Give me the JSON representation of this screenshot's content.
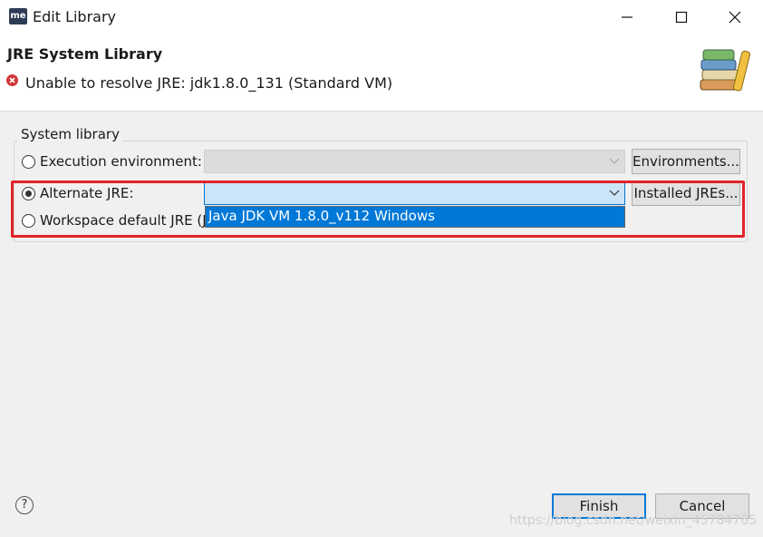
{
  "window": {
    "title": "Edit Library",
    "app_icon_text": "me"
  },
  "header": {
    "title": "JRE System Library",
    "error_message": "Unable to resolve JRE: jdk1.8.0_131 (Standard VM)"
  },
  "group": {
    "label": "System library",
    "options": {
      "execution_environment": {
        "label": "Execution environment:",
        "selected": false,
        "button": "Environments..."
      },
      "alternate_jre": {
        "label": "Alternate JRE:",
        "selected": true,
        "value": "",
        "button": "Installed JREs..."
      },
      "workspace_default": {
        "label": "Workspace default JRE (J",
        "selected": false
      }
    },
    "dropdown_items": [
      "Java JDK VM 1.8.0_v112 Windows"
    ]
  },
  "footer": {
    "finish": "Finish",
    "cancel": "Cancel",
    "help": "?"
  },
  "watermark": "https://blog.csdn.net/weixin_45784765",
  "colors": {
    "accent": "#0078d7",
    "highlight": "#e1232a",
    "error": "#d03838"
  },
  "icons": [
    "me-app-icon",
    "minimize-icon",
    "maximize-icon",
    "close-icon",
    "error-icon",
    "books-icon",
    "chevron-down-icon",
    "help-icon"
  ]
}
